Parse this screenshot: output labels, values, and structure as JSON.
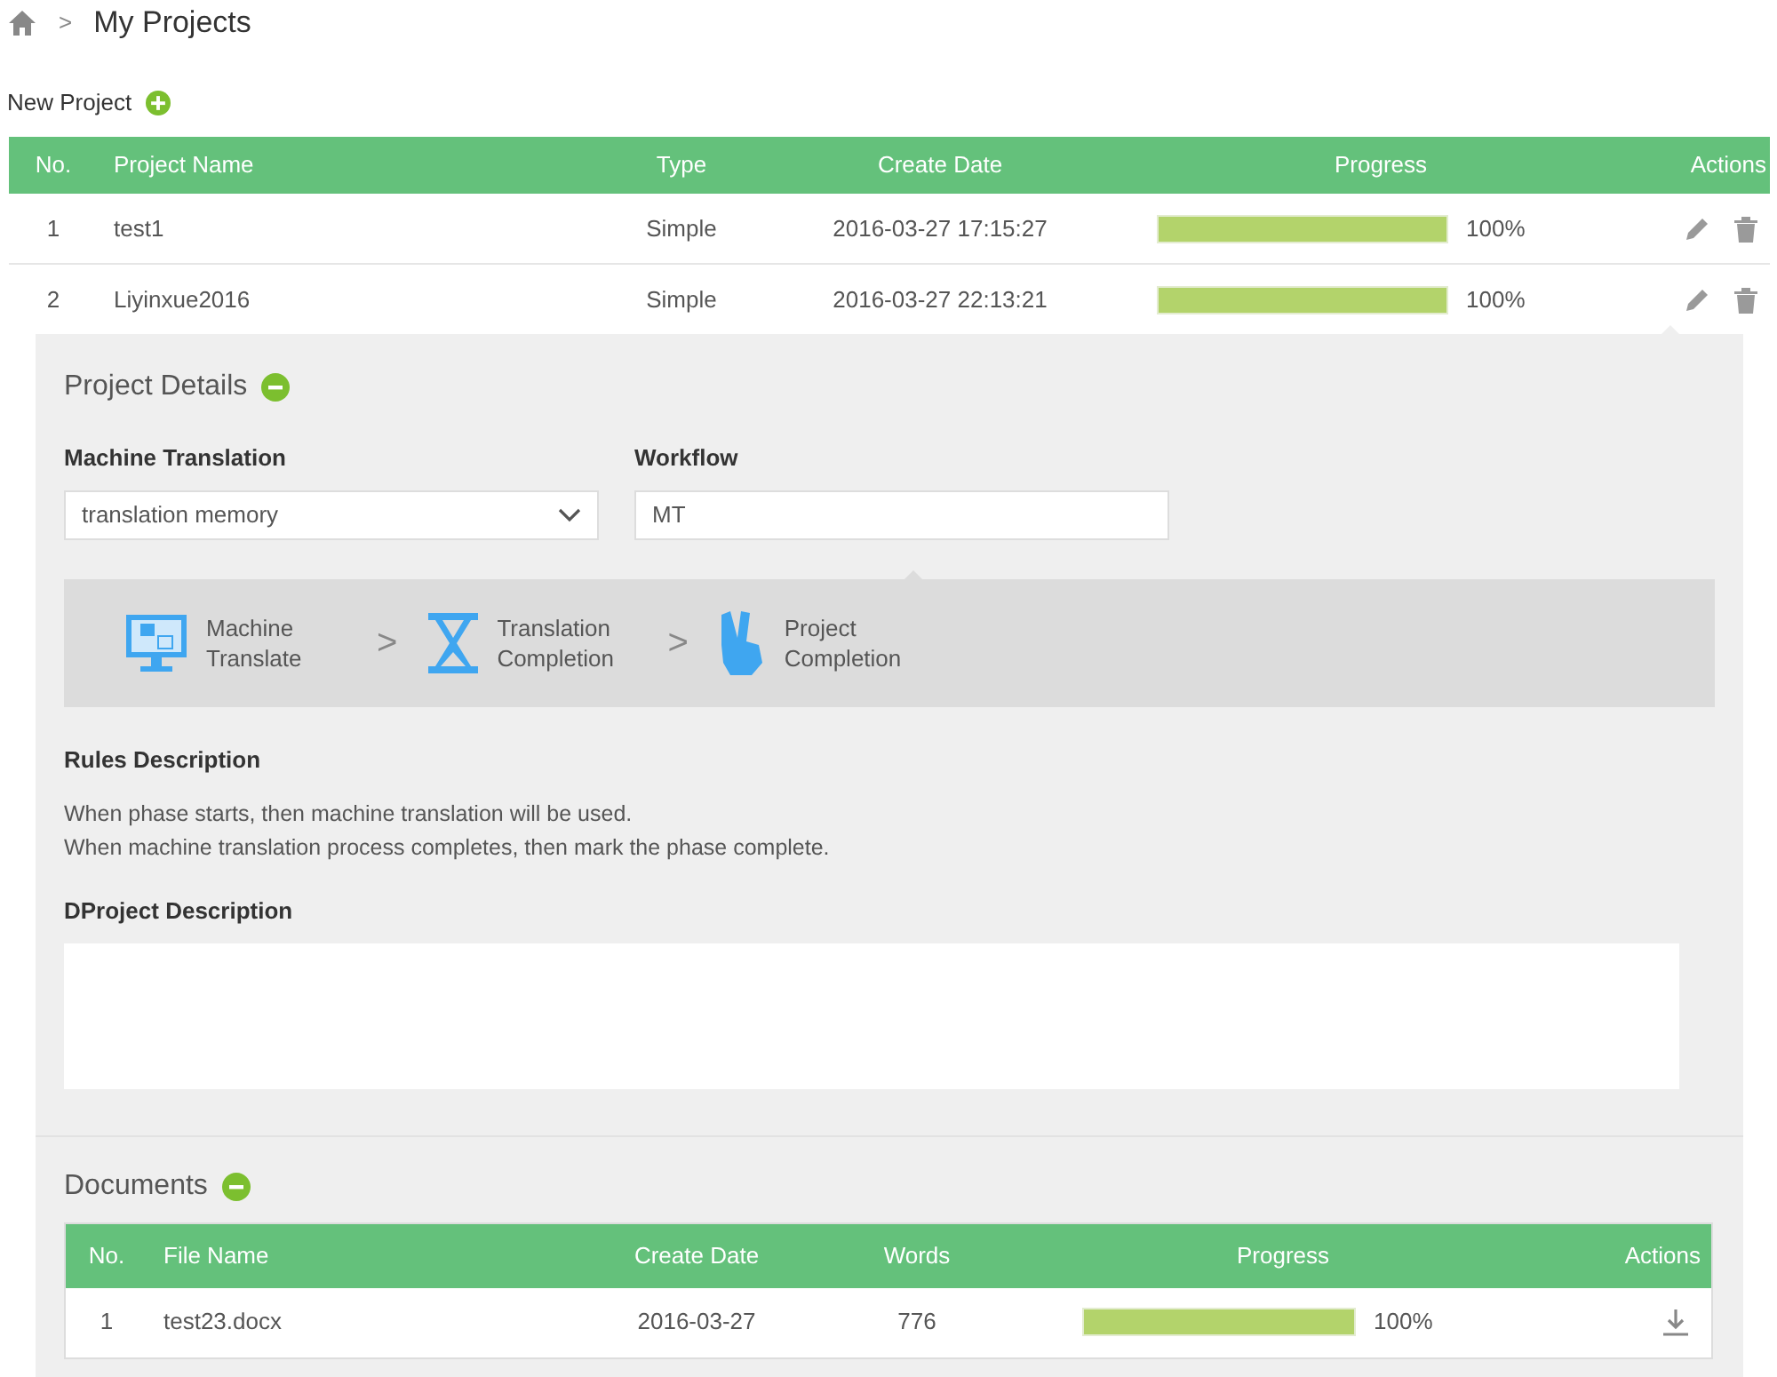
{
  "breadcrumb": {
    "current": "My Projects",
    "separator": ">"
  },
  "new_project": {
    "label": "New Project"
  },
  "projects": {
    "columns": [
      "No.",
      "Project Name",
      "Type",
      "Create Date",
      "Progress",
      "Actions"
    ],
    "rows": [
      {
        "no": "1",
        "name": "test1",
        "type": "Simple",
        "date": "2016-03-27 17:15:27",
        "level": 1,
        "percent": "100%",
        "expanded": false
      },
      {
        "no": "2",
        "name": "Liyinxue2016",
        "type": "Simple",
        "date": "2016-03-27 22:13:21",
        "level": 1,
        "percent": "100%",
        "expanded": true
      }
    ]
  },
  "details": {
    "title": "Project Details",
    "machine_translation": {
      "label": "Machine Translation",
      "value": "translation memory"
    },
    "workflow": {
      "label": "Workflow",
      "value": "MT"
    },
    "steps": [
      {
        "kind": "monitor",
        "label": "Machine Translate"
      },
      {
        "kind": "hourglass",
        "label": "Translation Completion"
      },
      {
        "kind": "hand",
        "label": "Project Completion"
      }
    ],
    "step_separator": ">",
    "rules_title": "Rules Description",
    "rules": [
      "When phase starts, then machine translation will be used.",
      "When machine translation process completes, then mark the phase complete."
    ],
    "description_label": "DProject Description"
  },
  "documents": {
    "title": "Documents",
    "columns": [
      "No.",
      "File Name",
      "Create Date",
      "Words",
      "Progress",
      "Actions"
    ],
    "rows": [
      {
        "no": "1",
        "name": "test23.docx",
        "date": "2016-03-27",
        "words": "776",
        "level": 1,
        "percent": "100%"
      }
    ]
  }
}
